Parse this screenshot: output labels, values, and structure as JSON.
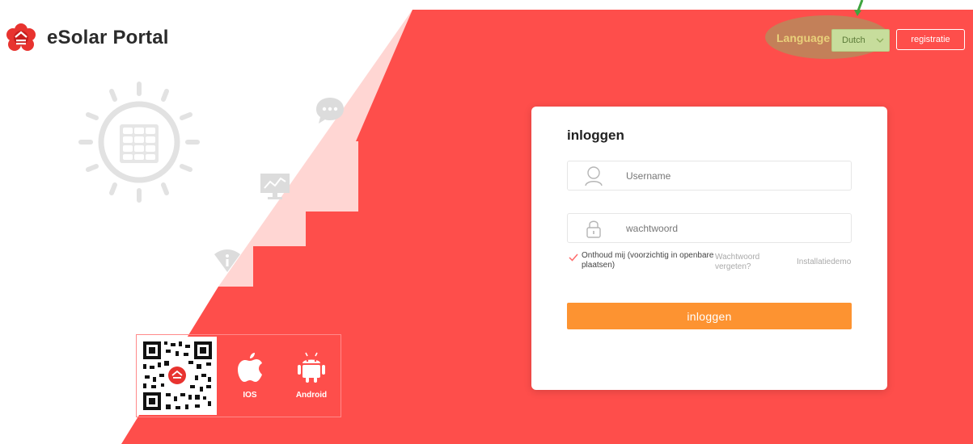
{
  "brand": {
    "title": "eSolar Portal",
    "accent": "#fe4a4a",
    "button_color": "#fd9331"
  },
  "header": {
    "language_label": "Language",
    "language_value": "Dutch",
    "register_label": "registratie"
  },
  "login": {
    "title": "inloggen",
    "username_placeholder": "Username",
    "password_placeholder": "wachtwoord",
    "remember_label": "Onthoud mij (voorzichtig in openbare plaatsen)",
    "forgot_label": "Wachtwoord vergeten?",
    "demo_label": "Installatiedemo",
    "submit_label": "inloggen"
  },
  "apps": {
    "ios_label": "IOS",
    "android_label": "Android"
  },
  "icons": [
    "logo-icon",
    "sun-panel-icon",
    "chat-icon",
    "monitor-chart-icon",
    "wifi-info-icon",
    "user-icon",
    "lock-icon",
    "check-icon",
    "chevron-down-icon",
    "qr-code-icon",
    "apple-icon",
    "android-icon",
    "arrow-indicator-icon"
  ]
}
